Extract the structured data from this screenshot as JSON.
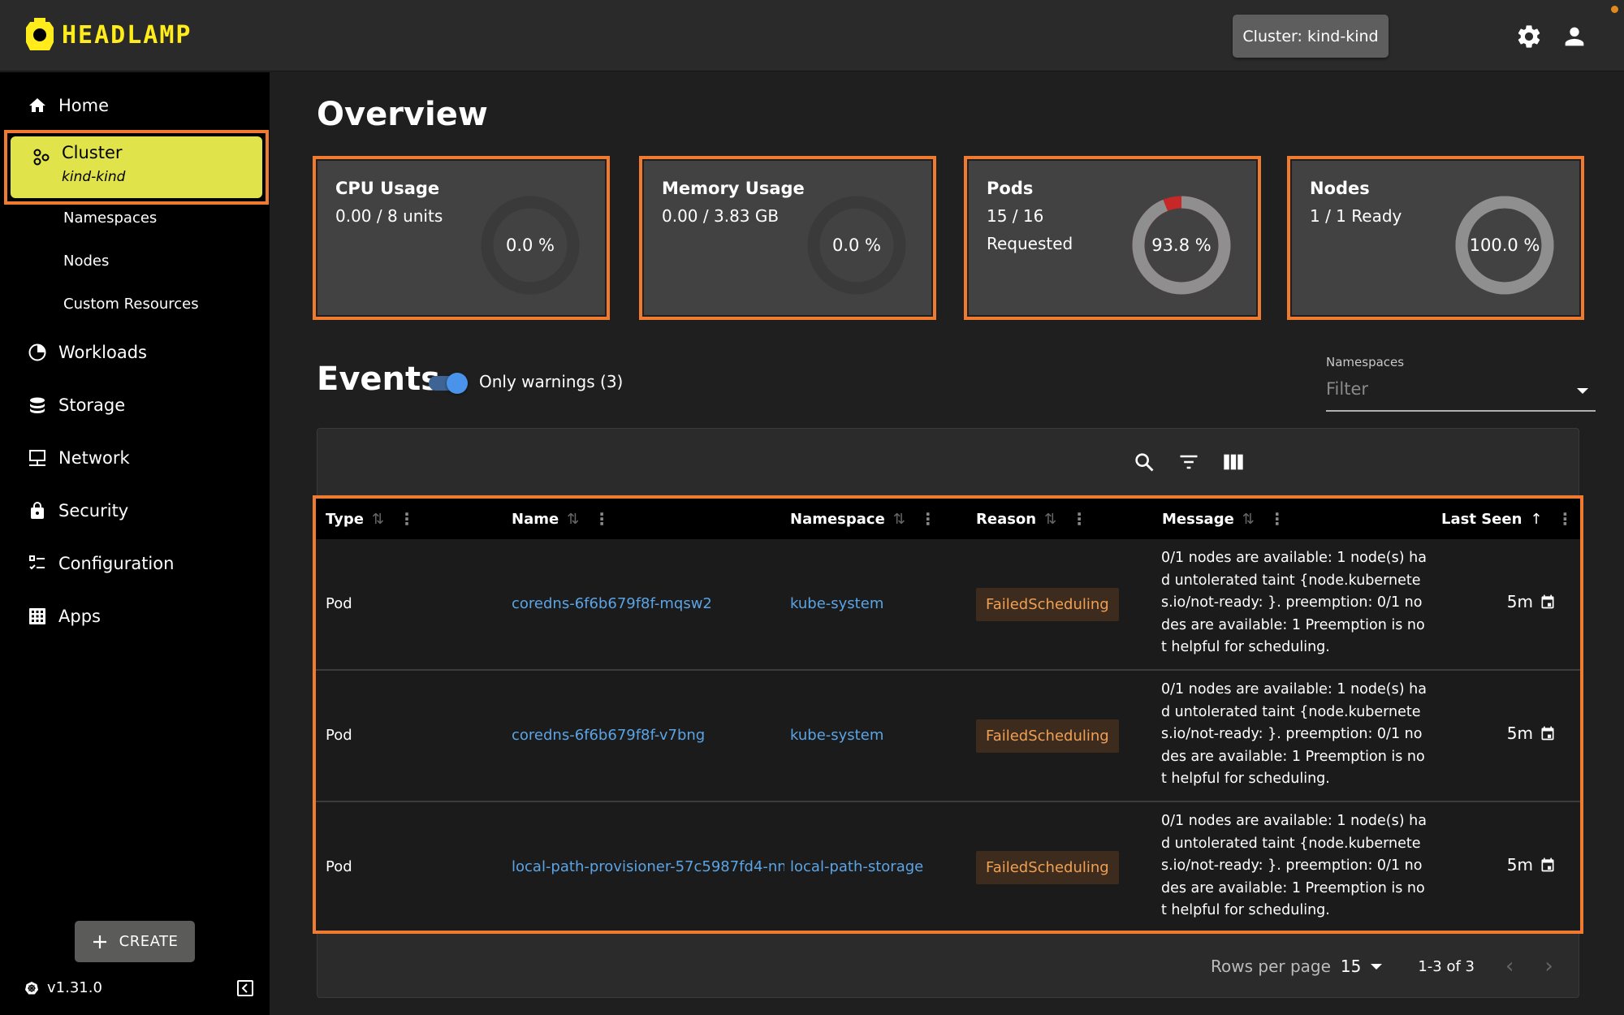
{
  "header": {
    "logo_text": "HEADLAMP",
    "cluster_button": "Cluster: kind-kind",
    "settings_icon": "gear-icon",
    "user_icon": "account-icon",
    "accent_color": "#ffec1a"
  },
  "sidebar": {
    "items": [
      {
        "label": "Home",
        "icon": "home-icon"
      },
      {
        "label": "Cluster",
        "sublabel": "kind-kind",
        "icon": "cluster-icon",
        "selected": true,
        "children": [
          {
            "label": "Namespaces"
          },
          {
            "label": "Nodes"
          },
          {
            "label": "Custom Resources"
          }
        ]
      },
      {
        "label": "Workloads",
        "icon": "workloads-icon"
      },
      {
        "label": "Storage",
        "icon": "storage-icon"
      },
      {
        "label": "Network",
        "icon": "network-icon"
      },
      {
        "label": "Security",
        "icon": "lock-icon"
      },
      {
        "label": "Configuration",
        "icon": "configuration-icon"
      },
      {
        "label": "Apps",
        "icon": "apps-icon"
      }
    ],
    "create_button": "CREATE",
    "version": "v1.31.0",
    "selected_color": "#e1e34b"
  },
  "main": {
    "title": "Overview",
    "cards": [
      {
        "title": "CPU Usage",
        "lines": [
          "0.00 / 8 units"
        ],
        "percent_label": "0.0 %",
        "percent": 0.0
      },
      {
        "title": "Memory Usage",
        "lines": [
          "0.00 / 3.83 GB"
        ],
        "percent_label": "0.0 %",
        "percent": 0.0
      },
      {
        "title": "Pods",
        "lines": [
          "15 / 16",
          "Requested"
        ],
        "percent_label": "93.8 %",
        "percent": 93.8,
        "remainder_color": "#c62828"
      },
      {
        "title": "Nodes",
        "lines": [
          "1 / 1 Ready"
        ],
        "percent_label": "100.0 %",
        "percent": 100.0
      }
    ],
    "events": {
      "title": "Events",
      "toggle_label": "Only warnings (3)",
      "toggle_on": true,
      "namespace_filter": {
        "label": "Namespaces",
        "placeholder": "Filter",
        "value": ""
      },
      "toolbar_icons": [
        "search-icon",
        "filter-icon",
        "columns-icon"
      ],
      "columns": [
        {
          "label": "Type",
          "sort": "none"
        },
        {
          "label": "Name",
          "sort": "none"
        },
        {
          "label": "Namespace",
          "sort": "none"
        },
        {
          "label": "Reason",
          "sort": "none"
        },
        {
          "label": "Message",
          "sort": "none"
        },
        {
          "label": "Last Seen",
          "sort": "asc"
        }
      ],
      "rows": [
        {
          "type": "Pod",
          "name": "coredns-6f6b679f8f-mqsw2",
          "namespace": "kube-system",
          "reason": "FailedScheduling",
          "message": "0/1 nodes are available: 1 node(s) had untolerated taint {node.kubernetes.io/not-ready: }. preemption: 0/1 nodes are available: 1 Preemption is not helpful for scheduling.",
          "last_seen": "5m"
        },
        {
          "type": "Pod",
          "name": "coredns-6f6b679f8f-v7bng",
          "namespace": "kube-system",
          "reason": "FailedScheduling",
          "message": "0/1 nodes are available: 1 node(s) had untolerated taint {node.kubernetes.io/not-ready: }. preemption: 0/1 nodes are available: 1 Preemption is not helpful for scheduling.",
          "last_seen": "5m"
        },
        {
          "type": "Pod",
          "name": "local-path-provisioner-57c5987fd4-nn",
          "namespace": "local-path-storage",
          "reason": "FailedScheduling",
          "message": "0/1 nodes are available: 1 node(s) had untolerated taint {node.kubernetes.io/not-ready: }. preemption: 0/1 nodes are available: 1 Preemption is not helpful for scheduling.",
          "last_seen": "5m"
        }
      ],
      "pagination": {
        "rows_per_page_label": "Rows per page",
        "rows_per_page": "15",
        "range": "1-3 of 3"
      }
    }
  }
}
